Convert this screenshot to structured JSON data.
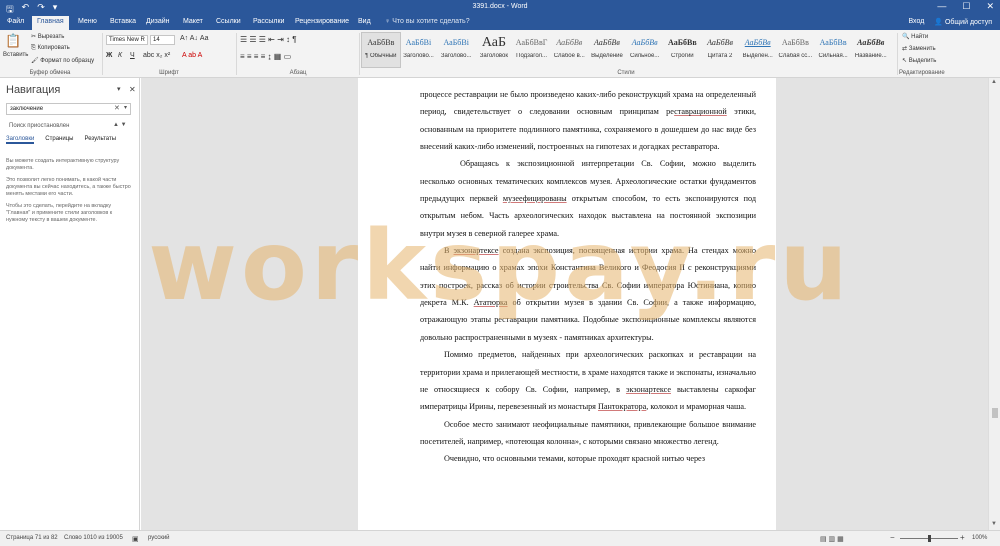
{
  "titlebar": {
    "title": "3391.docx - Word",
    "qat_save": "🖫",
    "qat_undo": "↶",
    "qat_redo": "↷",
    "qat_more": "▾",
    "min": "—",
    "max": "☐",
    "close": "✕"
  },
  "tabs": [
    "Файл",
    "Главная",
    "Меню",
    "Вставка",
    "Дизайн",
    "Макет",
    "Ссылки",
    "Рассылки",
    "Рецензирование",
    "Вид"
  ],
  "tell_me": "Что вы хотите сделать?",
  "account": {
    "signin": "Вход",
    "share": "Общий доступ"
  },
  "clipboard": {
    "paste": "Вставить",
    "cut": "Вырезать",
    "copy": "Копировать",
    "format_painter": "Формат по образцу",
    "label": "Буфер обмена"
  },
  "font": {
    "name": "Times New R",
    "size": "14",
    "label": "Шрифт"
  },
  "paragraph": {
    "label": "Абзац"
  },
  "styles": {
    "label": "Стили",
    "items": [
      {
        "sample": "АаБбВв",
        "name": "¶ Обычный"
      },
      {
        "sample": "АаБбВі",
        "name": "Заголово..."
      },
      {
        "sample": "АаБбВі",
        "name": "Заголово..."
      },
      {
        "sample": "АаБ",
        "name": "Заголовок"
      },
      {
        "sample": "АаБбВвГ",
        "name": "Подзагол..."
      },
      {
        "sample": "АаБбВв",
        "name": "Слабое в..."
      },
      {
        "sample": "АаБбВв",
        "name": "Выделение"
      },
      {
        "sample": "АаБбВв",
        "name": "Сильное..."
      },
      {
        "sample": "АаБбВв",
        "name": "Строгий"
      },
      {
        "sample": "АаБбВв",
        "name": "Цитата 2"
      },
      {
        "sample": "АаБбВв",
        "name": "Выделен..."
      },
      {
        "sample": "АаБбВв",
        "name": "Слабая сс..."
      },
      {
        "sample": "АаБбВв",
        "name": "Сильная..."
      },
      {
        "sample": "АаБбВв",
        "name": "Название..."
      }
    ]
  },
  "editing": {
    "find": "Найти",
    "replace": "Заменить",
    "select": "Выделить",
    "label": "Редактирование"
  },
  "nav": {
    "title": "Навигация",
    "search_value": "заключение",
    "status": "Поиск приостановлен",
    "tabs": [
      "Заголовки",
      "Страницы",
      "Результаты"
    ],
    "help": [
      "Вы можете создать интерактивную структуру документа.",
      "Это позволит легко понимать, в какой части документа вы сейчас находитесь, а также быстро менять местами его части.",
      "Чтобы это сделать, перейдите на вкладку \"Главная\" и примените стили заголовков к нужному тексту в вашем документе."
    ]
  },
  "document": {
    "p1_a": "процессе реставрации не было произведено каких-либо реконструкций храма на определенный период, свидетельствует о следовании основным принципам ре",
    "p1_u": "ставрационной",
    "p1_b": " этики, основанным на приоритете подлинного памятника, сохраняемого в дошедшем до нас виде без внесений каких-либо изменений, построенных на гипотезах и догадках реставратора.",
    "p2_a": "Обращаясь к экспозиционной интерпретации Св. Софии, можно выделить несколько основных тематических комплексов музея. Археологические остатки фундаментов предыдущих перквей ",
    "p2_u": "музеефицированы",
    "p2_b": " открытым способом, то есть экспонируются под открытым небом. Часть археологических находок выставлена на постоянной экспозиции внутри музея в северной галерее храма.",
    "p3_a": "В ",
    "p3_u1": "экзонартексе",
    "p3_b": " создана экспозиция, посвященная истории храма. На стендах можно найти информацию о храмах эпохи Константина Великого и Феодосия II с реконструкциями этих построек, рассказ об истории строительства Св. Софии императора Юстиниана, копию декрета М.К. ",
    "p3_u2": "Ататюрка",
    "p3_c": " об открытии музея в здании Св. Софии, а также информацию, отражающую этапы реставрации памятника. Подобные экспозиционные комплексы являются довольно распространенными в музеях - памятниках архитектуры.",
    "p4_a": "Помимо предметов, найденных при археологических раскопках и реставрации на территории храма и прилегающей местности, в храме находятся также и экспонаты, изначально не относящиеся к собору Св. Софии, например, в ",
    "p4_u1": "экзонартексе",
    "p4_b": " выставлены саркофаг императрицы Ирины, перевезенный из монастыря ",
    "p4_u2": "Пантократора",
    "p4_c": ", колокол и мраморная чаша.",
    "p5": "Особое место занимают неофициальные памятники, привлекающие большое внимание посетителей, например, «потеющая колонна», с которыми связано множество легенд.",
    "p6": "Очевидно, что основными темами, которые проходят красной нитью через"
  },
  "statusbar": {
    "page": "Страница 71 из 82",
    "words": "Слово 1010 из 19005",
    "lang": "русский",
    "zoom": "100%"
  },
  "watermark": "workspay.ru",
  "colors": {
    "accent": "#2b579a",
    "ribbon_bg": "#f3f3f3",
    "doc_bg": "#e3e3e3",
    "watermark": "#e6b46e"
  }
}
